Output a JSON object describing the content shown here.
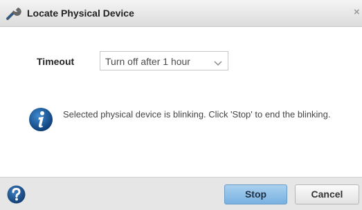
{
  "dialog": {
    "title": "Locate Physical Device",
    "close_glyph": "×",
    "title_icon": "wrench-icon"
  },
  "form": {
    "timeout_label": "Timeout",
    "timeout_value": "Turn off after 1 hour"
  },
  "message": {
    "icon": "info-icon",
    "text": "Selected physical device is blinking. Click 'Stop' to end the blinking."
  },
  "footer": {
    "help_icon": "help-icon",
    "stop_label": "Stop",
    "cancel_label": "Cancel"
  },
  "colors": {
    "accent": "#1f5e9e",
    "stop_button": "#8fc0e8"
  }
}
